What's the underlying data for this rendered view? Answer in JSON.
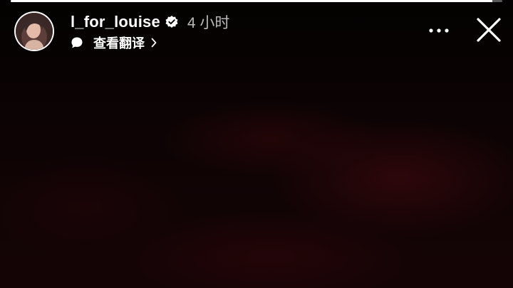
{
  "story": {
    "progress": 0.98,
    "background": "dark-red-low-light-photo"
  },
  "header": {
    "username": "l_for_louise",
    "verified_icon": "verified-badge-icon",
    "time": "4 小时",
    "translate_icon": "speech-bubble-icon",
    "translate_label": "查看翻译",
    "translate_chevron_icon": "chevron-right-icon"
  },
  "actions": {
    "more_icon": "more-horizontal-icon",
    "close_icon": "close-icon"
  },
  "colors": {
    "background": "#000000",
    "progress_fill": "#ffffff",
    "progress_track": "#5a5a5a",
    "text_primary": "#ffffff",
    "text_secondary": "#b8b8b8"
  }
}
